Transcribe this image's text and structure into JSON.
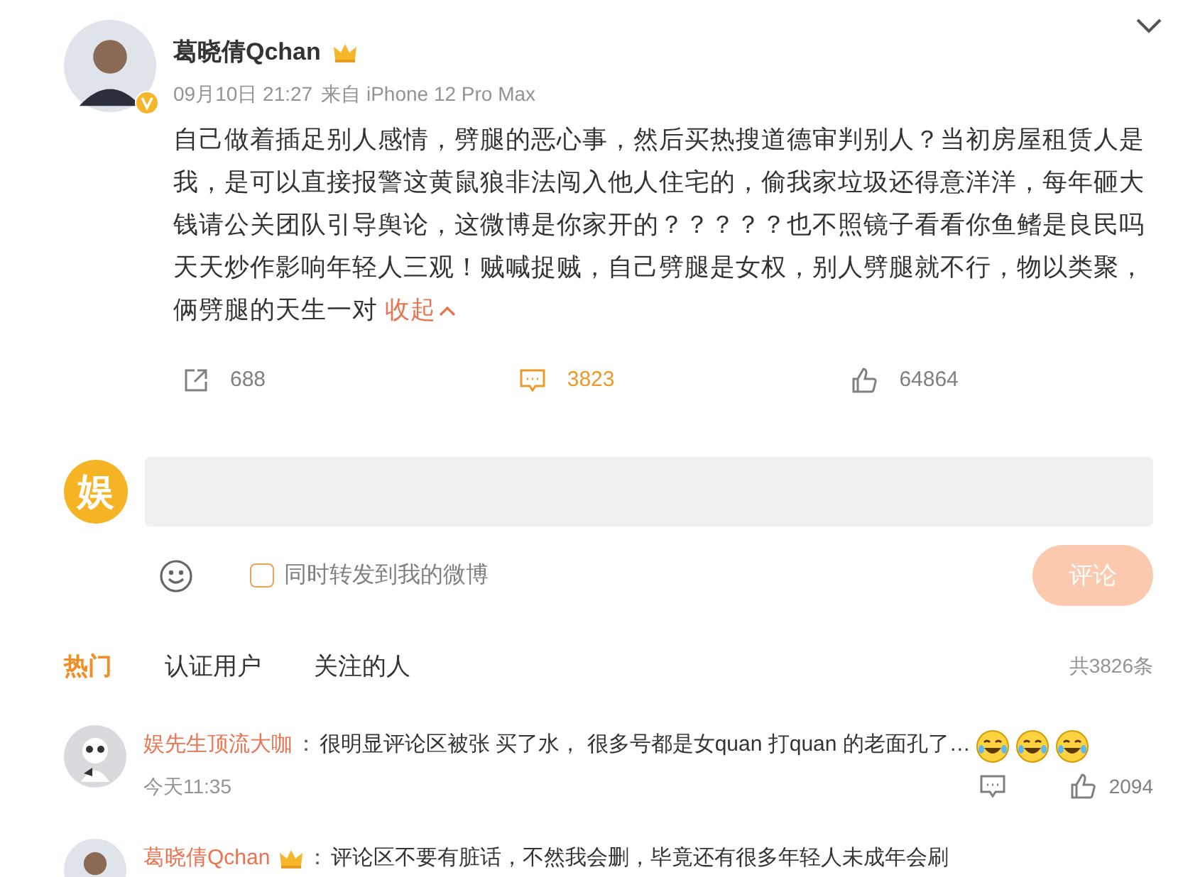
{
  "post": {
    "author": "葛晓倩Qchan",
    "verified": true,
    "time": "09月10日 21:27",
    "source": "来自 iPhone 12 Pro Max",
    "text": "自己做着插足别人感情，劈腿的恶心事，然后买热搜道德审判别人？当初房屋租赁人是我，是可以直接报警这黄鼠狼非法闯入他人住宅的，偷我家垃圾还得意洋洋，每年砸大钱请公关团队引导舆论，这微博是你家开的？？？？？也不照镜子看看你鱼鳍是良民吗天天炒作影响年轻人三观！贼喊捉贼，自己劈腿是女权，别人劈腿就不行，物以类聚，俩劈腿的天生一对",
    "collapse_link": "收起",
    "actions": [
      {
        "kind": "repost",
        "count": "688",
        "selected": false
      },
      {
        "kind": "comment",
        "count": "3823",
        "selected": true
      },
      {
        "kind": "like",
        "count": "64864",
        "selected": false
      }
    ]
  },
  "composer": {
    "avatar_text": "娱",
    "share_option": {
      "label": "同时转发到我的微博",
      "checked": false
    },
    "submit": "评论",
    "submit_disabled": true
  },
  "comment_tabs": [
    {
      "label": "热门",
      "selected": true
    },
    {
      "label": "认证用户",
      "selected": false
    },
    {
      "label": "关注的人",
      "selected": false
    }
  ],
  "comment_total": "共3826条",
  "comments": [
    {
      "author": "娱先生顶流大咖",
      "badge": false,
      "separator": "：",
      "text": "很明显评论区被张 买了水， 很多号都是女quan 打quan 的老面孔了…",
      "emojis": [
        {
          "kind": "laughing"
        },
        {
          "kind": "laughing"
        },
        {
          "kind": "laughing"
        }
      ],
      "time": "今天11:35",
      "likes": "2094"
    },
    {
      "author": "葛晓倩Qchan",
      "badge": true,
      "separator": "：",
      "text": "评论区不要有脏话，不然我会删，毕竟还有很多年轻人未成年会刷"
    }
  ]
}
